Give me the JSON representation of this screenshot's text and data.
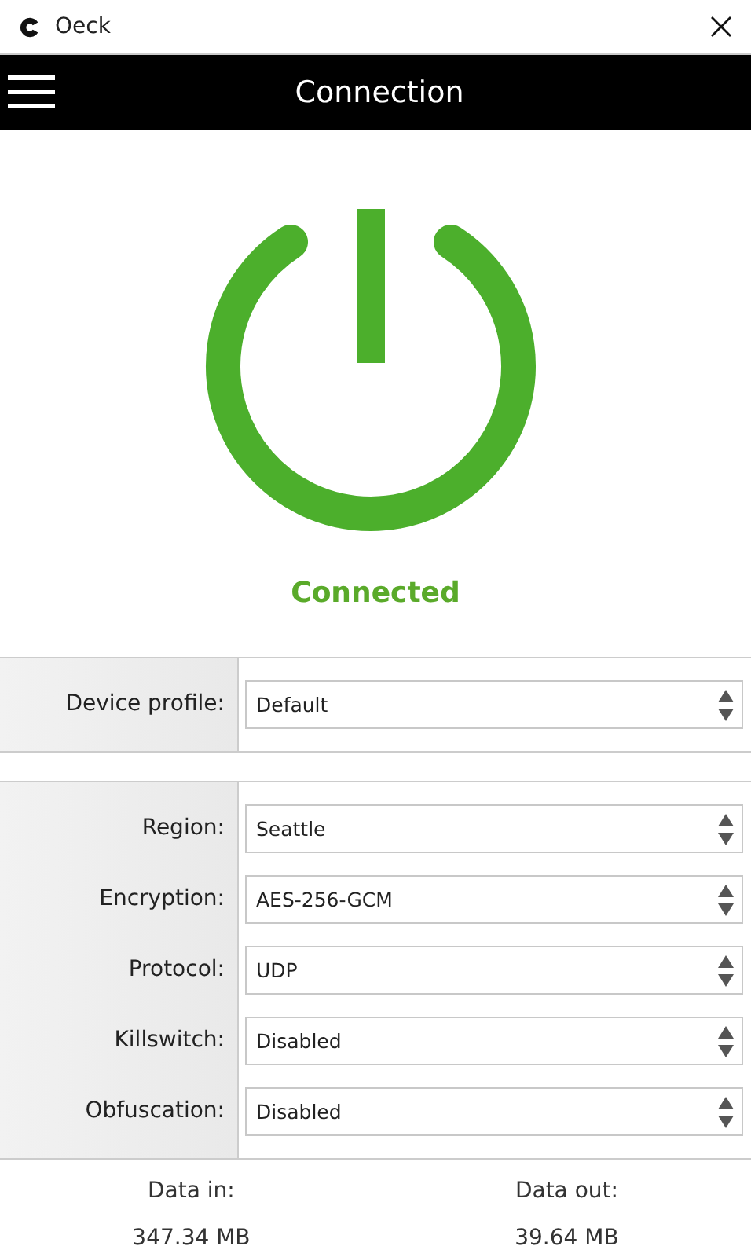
{
  "window": {
    "title": "Oeck"
  },
  "header": {
    "title": "Connection"
  },
  "status": {
    "label": "Connected",
    "connected": true
  },
  "profile": [
    {
      "label": "Device profile:",
      "value": "Default"
    }
  ],
  "settings": [
    {
      "label": "Region:",
      "value": "Seattle"
    },
    {
      "label": "Encryption:",
      "value": "AES-256-GCM"
    },
    {
      "label": "Protocol:",
      "value": "UDP"
    },
    {
      "label": "Killswitch:",
      "value": "Disabled"
    },
    {
      "label": "Obfuscation:",
      "value": "Disabled"
    }
  ],
  "traffic": [
    {
      "label": "Data in:",
      "value": "347.34 MB"
    },
    {
      "label": "Data out:",
      "value": "39.64 MB"
    }
  ]
}
